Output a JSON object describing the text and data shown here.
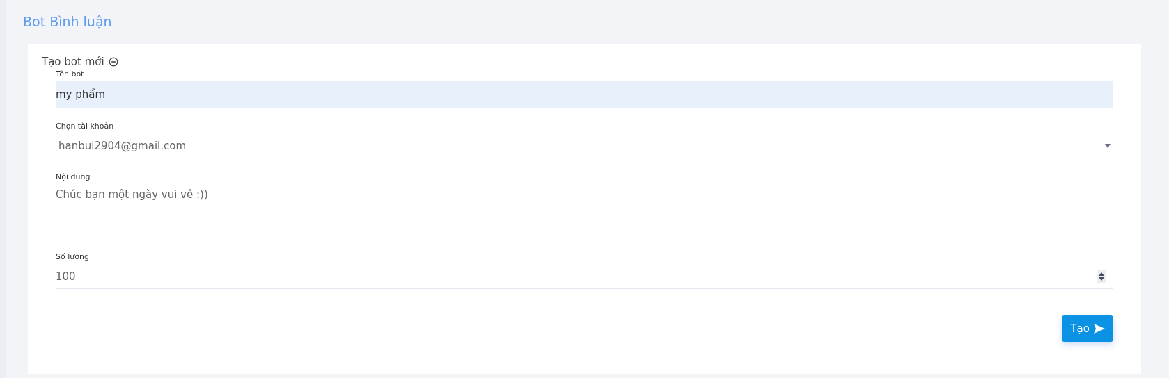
{
  "page_title": "Bot Bình luận",
  "section": {
    "title": "Tạo bot mới",
    "expanded": true
  },
  "fields": [
    {
      "kind": "text",
      "label": "Tên bot",
      "value": "mỹ phẩm",
      "focused": true
    },
    {
      "kind": "select",
      "label": "Chọn tài khoản",
      "value": "hanbui2904@gmail.com"
    },
    {
      "kind": "textarea",
      "label": "Nội dung",
      "value": "Chúc bạn một ngày vui vẻ :))"
    },
    {
      "kind": "number",
      "label": "Số lượng",
      "value": "100"
    }
  ],
  "submit_button": "Tạo"
}
